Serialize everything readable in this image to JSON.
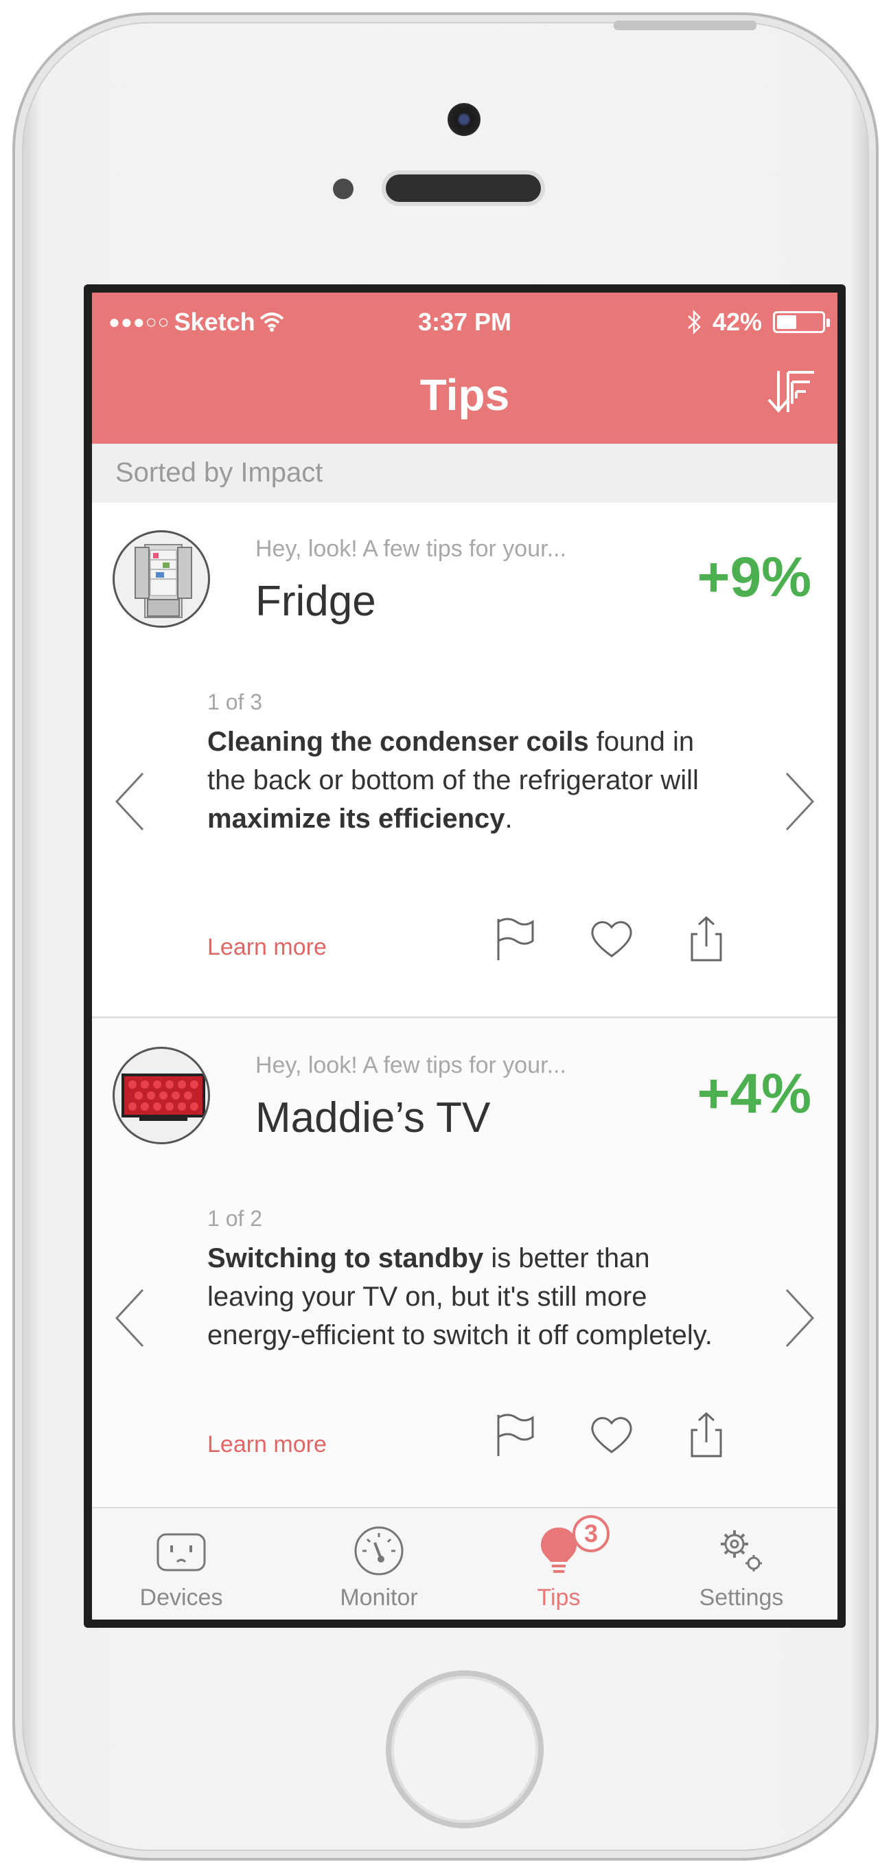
{
  "status_bar": {
    "signal": "●●●○○",
    "carrier": "Sketch",
    "time": "3:37 PM",
    "battery_percent": "42%",
    "battery_level": 0.42
  },
  "header": {
    "title": "Tips"
  },
  "sort_bar": {
    "label": "Sorted by Impact"
  },
  "cards": [
    {
      "subtitle": "Hey, look! A few tips for your...",
      "device": "Fridge",
      "impact": "+9%",
      "counter": "1 of 3",
      "tip_parts": {
        "b1": "Cleaning the condenser coils",
        "t1": " found in the back or bottom of the refrigerator will ",
        "b2": "maximize its efficiency",
        "t2": "."
      },
      "learn_more": "Learn more"
    },
    {
      "subtitle": "Hey, look! A few tips for your...",
      "device": "Maddie’s TV",
      "impact": "+4%",
      "counter": "1 of 2",
      "tip_parts": {
        "b1": "Switching to standby",
        "t1": " is better than leaving your TV on, but it's still more energy-efficient to switch it off completely."
      },
      "learn_more": "Learn more"
    }
  ],
  "tabbar": {
    "tabs": [
      {
        "label": "Devices",
        "icon": "outlet-icon"
      },
      {
        "label": "Monitor",
        "icon": "gauge-icon"
      },
      {
        "label": "Tips",
        "icon": "lightbulb-icon",
        "badge": "3",
        "active": true
      },
      {
        "label": "Settings",
        "icon": "gears-icon"
      }
    ]
  },
  "colors": {
    "accent": "#e87777",
    "impact_green": "#4caf50",
    "link": "#e06666"
  }
}
